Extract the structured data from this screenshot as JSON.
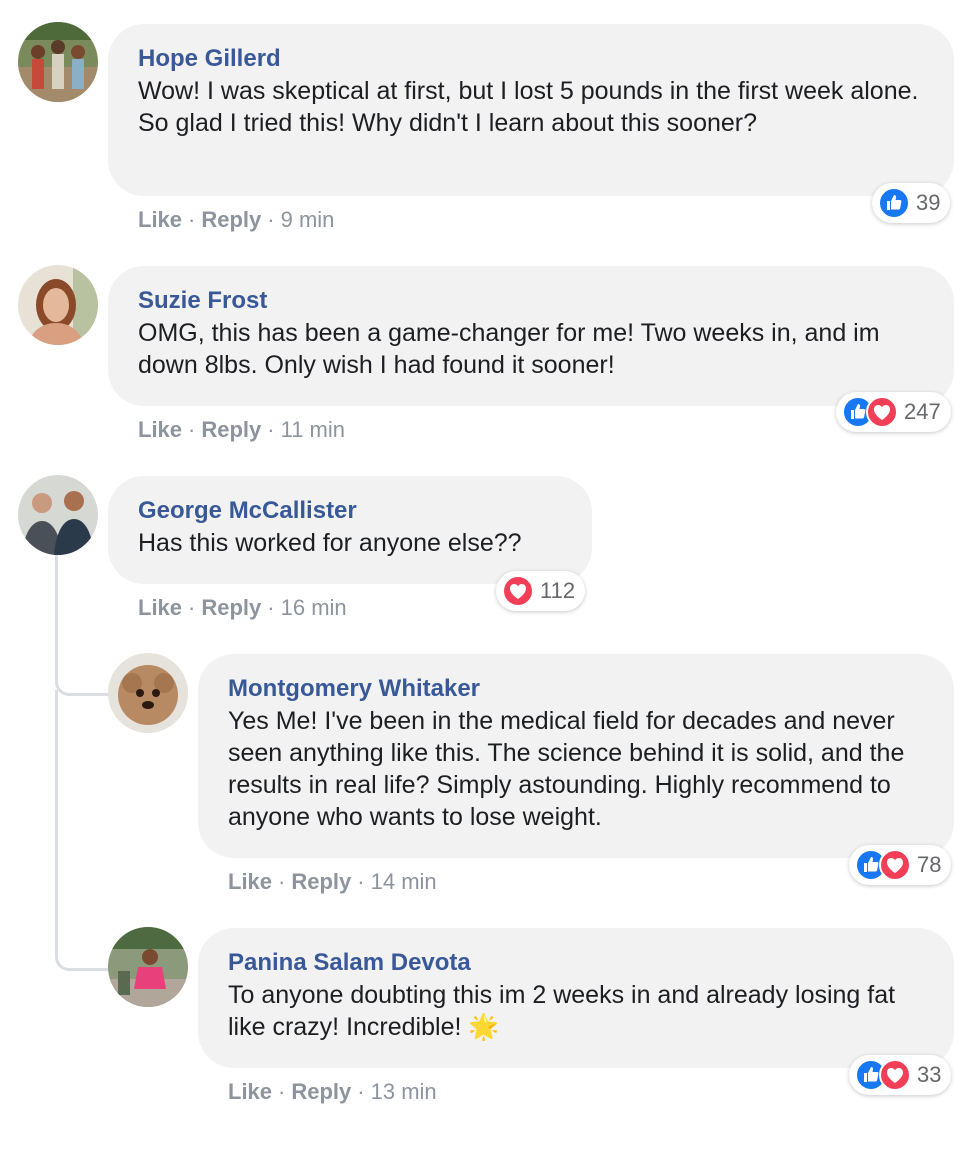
{
  "comments": [
    {
      "author": "Hope Gillerd",
      "text": "Wow! I was skeptical at first, but I lost 5 pounds in the first week alone. So glad I tried this! Why didn't I learn about this sooner?",
      "like": "Like",
      "reply": "Reply",
      "time": "9 min",
      "reaction_count": "39",
      "reactions": [
        "like-icon"
      ]
    },
    {
      "author": "Suzie Frost",
      "text": "OMG, this has been a game-changer for me! Two weeks in, and im down 8lbs. Only wish I had found it sooner!",
      "like": "Like",
      "reply": "Reply",
      "time": "11 min",
      "reaction_count": "247",
      "reactions": [
        "like-icon",
        "love-icon"
      ]
    },
    {
      "author": "George McCallister",
      "text": "Has this worked for anyone else??",
      "like": "Like",
      "reply": "Reply",
      "time": "16 min",
      "reaction_count": "112",
      "reactions": [
        "love-icon"
      ]
    },
    {
      "author": "Montgomery Whitaker",
      "text": "Yes Me! I've been in the medical field for decades and never seen anything like this. The science behind it is solid, and the results in real life? Simply astounding. Highly recommend to anyone who wants to lose weight.",
      "like": "Like",
      "reply": "Reply",
      "time": "14 min",
      "reaction_count": "78",
      "reactions": [
        "like-icon",
        "love-icon"
      ]
    },
    {
      "author": "Panina Salam Devota",
      "text": "To anyone doubting this im 2 weeks in and already losing fat like crazy! Incredible! ",
      "emoji": "🌟",
      "like": "Like",
      "reply": "Reply",
      "time": "13 min",
      "reaction_count": "33",
      "reactions": [
        "like-icon",
        "love-icon"
      ]
    }
  ],
  "separator": "·",
  "colors": {
    "author": "#385898",
    "bubble": "#f2f2f2",
    "meta": "#8d949e",
    "like": "#1877f2",
    "love": "#f33e58"
  }
}
